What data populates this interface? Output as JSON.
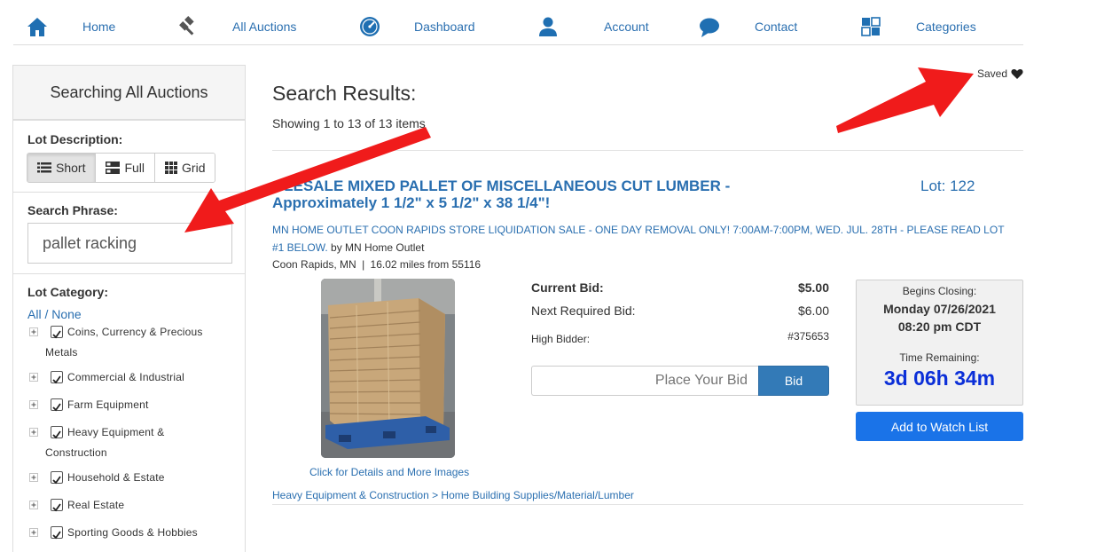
{
  "nav": {
    "items": [
      {
        "label": "Home",
        "icon": "home-icon"
      },
      {
        "label": "All Auctions",
        "icon": "gavel-icon"
      },
      {
        "label": "Dashboard",
        "icon": "dashboard-icon"
      },
      {
        "label": "Account",
        "icon": "user-icon"
      },
      {
        "label": "Contact",
        "icon": "chat-icon"
      },
      {
        "label": "Categories",
        "icon": "categories-icon"
      }
    ]
  },
  "sidebar": {
    "header": "Searching All Auctions",
    "lot_description_label": "Lot Description:",
    "view_modes": [
      "Short",
      "Full",
      "Grid"
    ],
    "selected_view": "Short",
    "search_phrase_label": "Search Phrase:",
    "search_phrase_value": "pallet racking",
    "lot_category_label": "Lot Category:",
    "all_none": "All / None",
    "categories": [
      {
        "line1": "Coins, Currency & Precious",
        "line2": "Metals",
        "checked": true
      },
      {
        "line1": "Commercial & Industrial",
        "line2": "",
        "checked": true
      },
      {
        "line1": "Farm Equipment",
        "line2": "",
        "checked": true
      },
      {
        "line1": "Heavy Equipment &",
        "line2": "Construction",
        "checked": true
      },
      {
        "line1": "Household & Estate",
        "line2": "",
        "checked": true
      },
      {
        "line1": "Real Estate",
        "line2": "",
        "checked": true
      },
      {
        "line1": "Sporting Goods & Hobbies",
        "line2": "",
        "checked": true
      }
    ]
  },
  "main": {
    "saved_label": "Saved",
    "results_title": "Search Results:",
    "showing_text": "Showing 1 to 13 of 13 items",
    "lot": {
      "title_line1": "OLESALE MIXED PALLET OF MISCELLANEOUS CUT LUMBER -",
      "title_line2": "Approximately 1 1/2\" x 5 1/2\" x 38 1/4\"!",
      "lot_number": "Lot: 122",
      "sale_text": "MN HOME OUTLET COON RAPIDS STORE LIQUIDATION SALE - ONE DAY REMOVAL ONLY! 7:00AM-7:00PM, WED. JUL. 28TH - PLEASE READ LOT #1 BELOW.",
      "seller_text": "by MN Home Outlet",
      "location_city": "Coon Rapids, MN",
      "location_distance": "16.02 miles from 55116",
      "click_details": "Click for Details and More Images",
      "current_bid_label": "Current Bid:",
      "current_bid_value": "$5.00",
      "next_bid_label": "Next Required Bid:",
      "next_bid_value": "$6.00",
      "high_bidder_label": "High Bidder:",
      "high_bidder_value": "#375653",
      "bid_placeholder": "Place Your Bid",
      "bid_button": "Bid",
      "closing_label": "Begins Closing:",
      "closing_date": "Monday 07/26/2021",
      "closing_time": "08:20 pm CDT",
      "time_remaining_label": "Time Remaining:",
      "time_remaining_value": "3d 06h 34m",
      "watch_button": "Add to Watch List",
      "breadcrumb": "Heavy Equipment & Construction > Home Building Supplies/Material/Lumber"
    }
  },
  "colors": {
    "link_blue": "#2a6fb0",
    "button_blue": "#337ab7",
    "watch_blue": "#1a73e8",
    "timer_blue": "#0b2fd8",
    "annotation_red": "#f01b1b"
  }
}
